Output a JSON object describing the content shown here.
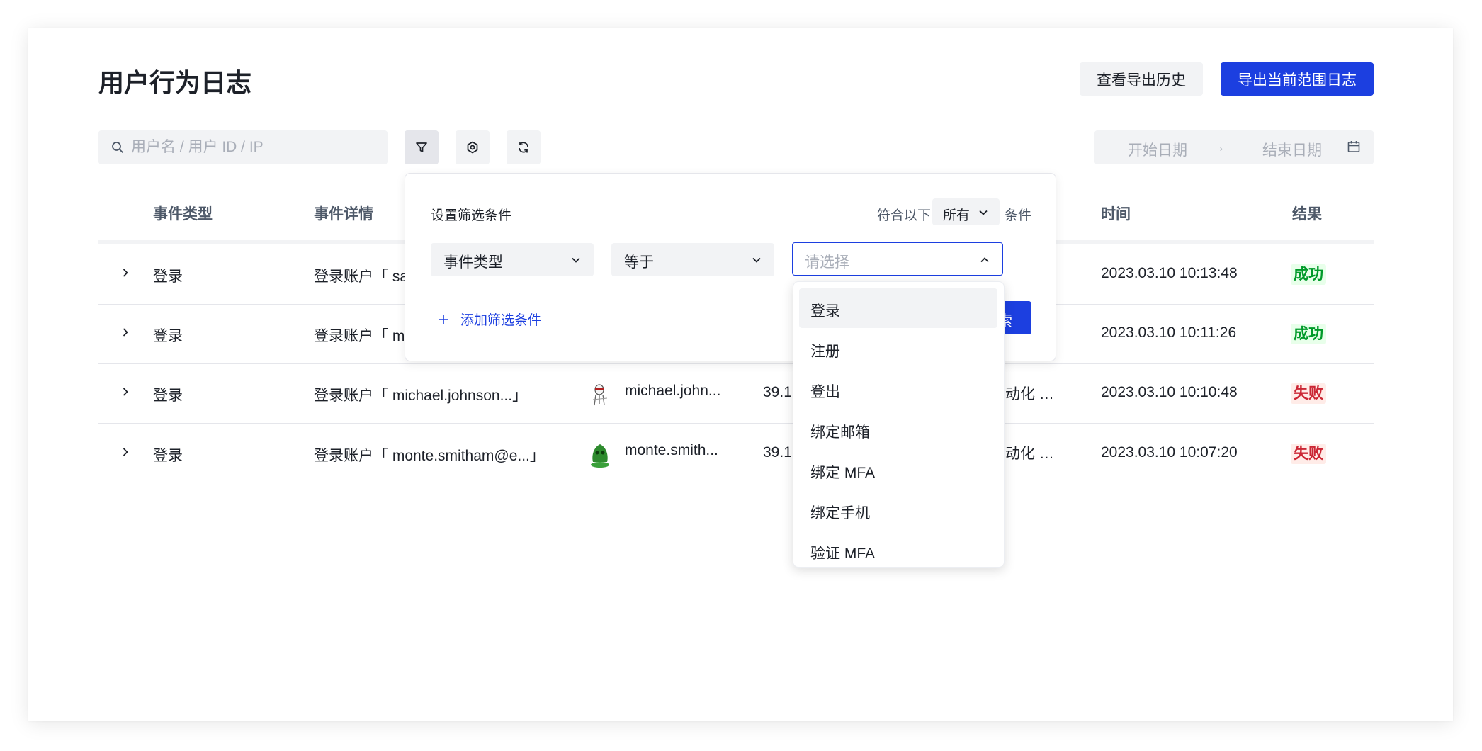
{
  "page": {
    "title": "用户行为日志",
    "view_history_button": "查看导出历史",
    "export_button": "导出当前范围日志"
  },
  "toolbar": {
    "search_placeholder": "用户名 / 用户 ID / IP",
    "date_start_placeholder": "开始日期",
    "date_arrow": "→",
    "date_end_placeholder": "结束日期"
  },
  "table": {
    "headers": {
      "event_type": "事件类型",
      "event_detail": "事件详情",
      "time": "时间",
      "result": "结果"
    },
    "rows": [
      {
        "type": "登录",
        "detail": "登录账户「 sa",
        "user": "",
        "ip": "",
        "device": "…",
        "time": "2023.03.10 10:13:48",
        "result": "成功",
        "status": "success"
      },
      {
        "type": "登录",
        "detail": "登录账户「 m",
        "user": "",
        "ip": "",
        "device": "…",
        "time": "2023.03.10 10:11:26",
        "result": "成功",
        "status": "success"
      },
      {
        "type": "登录",
        "detail": "登录账户「 michael.johnson...」",
        "user": "michael.john...",
        "ip": "39.1",
        "device": "自动化 …",
        "time": "2023.03.10 10:10:48",
        "result": "失败",
        "status": "fail"
      },
      {
        "type": "登录",
        "detail": "登录账户「 monte.smitham@e...」",
        "user": "monte.smith...",
        "ip": "39.1",
        "device": "自动化 …",
        "time": "2023.03.10 10:07:20",
        "result": "失败",
        "status": "fail"
      }
    ]
  },
  "filter_panel": {
    "title": "设置筛选条件",
    "match_prefix": "符合以下",
    "match_value": "所有",
    "match_suffix": "条件",
    "field_select": "事件类型",
    "operator_select": "等于",
    "value_placeholder": "请选择",
    "add_condition": "添加筛选条件",
    "search_button_partial": "索"
  },
  "dropdown": {
    "options": [
      "登录",
      "注册",
      "登出",
      "绑定邮箱",
      "绑定 MFA",
      "绑定手机",
      "验证 MFA"
    ],
    "highlighted_index": 0
  },
  "colors": {
    "primary": "#1c3fe0",
    "success": "#009a29",
    "fail": "#cb2634"
  }
}
